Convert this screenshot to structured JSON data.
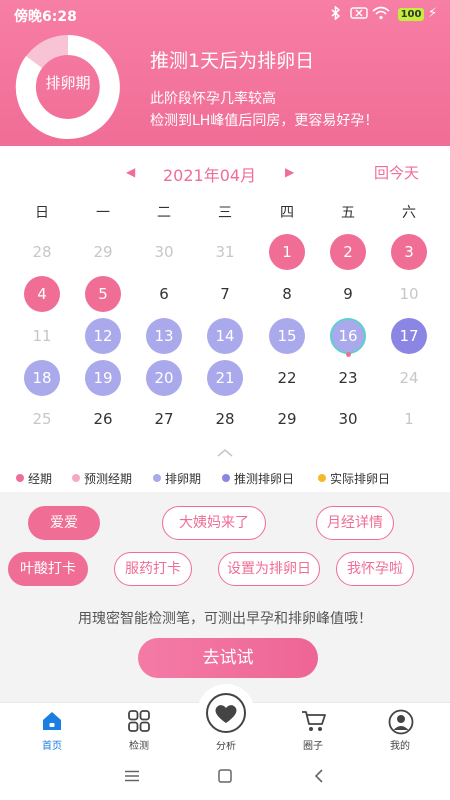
{
  "status_bar": {
    "time": "傍晚6:28",
    "battery": "100"
  },
  "header": {
    "ring_label": "排卵期",
    "title": "推测1天后为排卵日",
    "line1": "此阶段怀孕几率较高",
    "line2": "检测到LH峰值后同房，更容易好孕！"
  },
  "calendar": {
    "month": "2021年04月",
    "today_button": "回今天",
    "weekdays": [
      "日",
      "一",
      "二",
      "三",
      "四",
      "五",
      "六"
    ],
    "rows": [
      [
        {
          "d": "28",
          "t": "muted"
        },
        {
          "d": "29",
          "t": "muted"
        },
        {
          "d": "30",
          "t": "muted"
        },
        {
          "d": "31",
          "t": "muted"
        },
        {
          "d": "1",
          "t": "period"
        },
        {
          "d": "2",
          "t": "period"
        },
        {
          "d": "3",
          "t": "period"
        }
      ],
      [
        {
          "d": "4",
          "t": "period"
        },
        {
          "d": "5",
          "t": "period"
        },
        {
          "d": "6",
          "t": "normal"
        },
        {
          "d": "7",
          "t": "normal"
        },
        {
          "d": "8",
          "t": "normal"
        },
        {
          "d": "9",
          "t": "normal"
        },
        {
          "d": "10",
          "t": "muted"
        }
      ],
      [
        {
          "d": "11",
          "t": "muted"
        },
        {
          "d": "12",
          "t": "ovu"
        },
        {
          "d": "13",
          "t": "ovu"
        },
        {
          "d": "14",
          "t": "ovu"
        },
        {
          "d": "15",
          "t": "ovu"
        },
        {
          "d": "16",
          "t": "today"
        },
        {
          "d": "17",
          "t": "ovupeak"
        }
      ],
      [
        {
          "d": "18",
          "t": "ovu"
        },
        {
          "d": "19",
          "t": "ovu"
        },
        {
          "d": "20",
          "t": "ovu"
        },
        {
          "d": "21",
          "t": "ovu"
        },
        {
          "d": "22",
          "t": "normal"
        },
        {
          "d": "23",
          "t": "normal"
        },
        {
          "d": "24",
          "t": "muted"
        }
      ],
      [
        {
          "d": "25",
          "t": "muted"
        },
        {
          "d": "26",
          "t": "normal"
        },
        {
          "d": "27",
          "t": "normal"
        },
        {
          "d": "28",
          "t": "normal"
        },
        {
          "d": "29",
          "t": "normal"
        },
        {
          "d": "30",
          "t": "normal"
        },
        {
          "d": "1",
          "t": "muted"
        }
      ]
    ]
  },
  "legend": [
    {
      "label": "经期",
      "color": "#f06d96"
    },
    {
      "label": "预测经期",
      "color": "#f7a9c4"
    },
    {
      "label": "排卵期",
      "color": "#a9a9ec"
    },
    {
      "label": "推测排卵日",
      "color": "#8b86e3"
    },
    {
      "label": "实际排卵日",
      "color": "#f5b82a"
    }
  ],
  "actions": {
    "chips": [
      "爱爱",
      "大姨妈来了",
      "月经详情",
      "叶酸打卡",
      "服药打卡",
      "设置为排卵日",
      "我怀孕啦"
    ],
    "promo": "用瑰密智能检测笔，可测出早孕和排卵峰值哦！",
    "try_button": "去试试"
  },
  "tabs": [
    {
      "label": "首页"
    },
    {
      "label": "检测"
    },
    {
      "label": "分析"
    },
    {
      "label": "圈子"
    },
    {
      "label": "我的"
    }
  ],
  "colors": {
    "accent": "#f06d96",
    "ovulation": "#a9a9ec",
    "ovulation_day": "#8b86e3",
    "home_tab": "#1a7fe0"
  }
}
